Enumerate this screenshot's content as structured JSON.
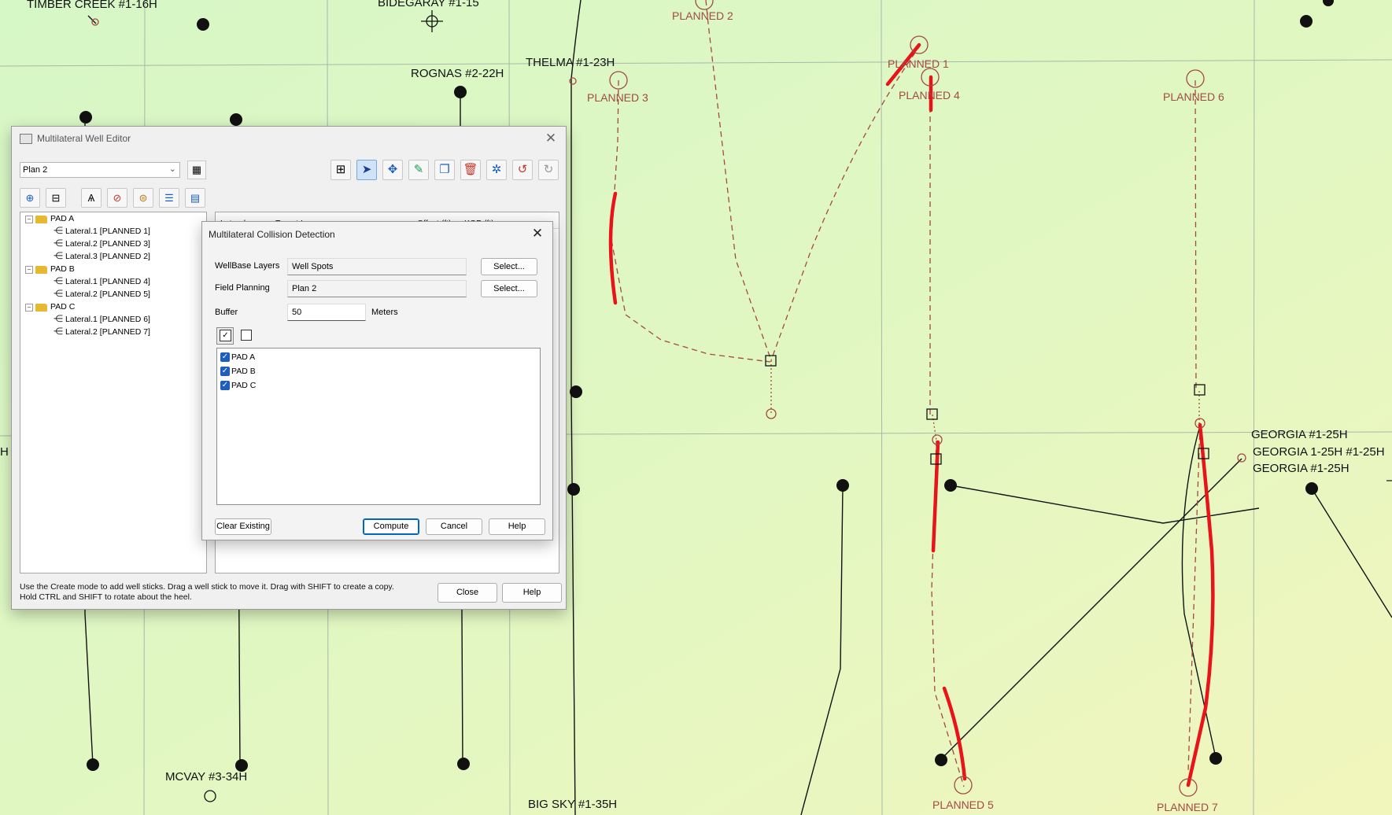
{
  "map": {
    "labels": {
      "timber_creek": "TIMBER CREEK #1-16H",
      "bidegaray": "BIDEGARAY #1-15",
      "rognas": "ROGNAS #2-22H",
      "thelma": "THELMA #1-23H",
      "georgia1": "GEORGIA #1-25H",
      "georgia2": "GEORGIA 1-25H #1-25H",
      "georgia3": "GEORGIA #1-25H",
      "mcvay": "MCVAY #3-34H",
      "bigsky": "BIG SKY #1-35H",
      "edge_h": "H"
    },
    "planned": {
      "p1": "PLANNED 1",
      "p2": "PLANNED 2",
      "p3": "PLANNED 3",
      "p4": "PLANNED 4",
      "p5": "PLANNED 5",
      "p6": "PLANNED 6",
      "p7": "PLANNED 7"
    },
    "colors": {
      "background_top": "#d9f7c4",
      "background_right": "#eff7c0",
      "planned_path": "#a24a45",
      "collision": "#e8141a",
      "grid": "#a8b4a8"
    }
  },
  "editor": {
    "title": "Multilateral Well Editor",
    "plan_select": "Plan 2",
    "toolbar_icons": [
      "new-well-icon",
      "select-arrow-icon",
      "move-icon",
      "pencil-icon",
      "copy-icon",
      "delete-icon",
      "collision-icon",
      "undo-icon",
      "redo-icon"
    ],
    "table_headers": [
      "Lateral",
      "Target Layer",
      "Offset (ft)",
      "KOP (ft)"
    ],
    "tree": [
      {
        "pad": "PAD A",
        "laterals": [
          "Lateral.1 [PLANNED 1]",
          "Lateral.2 [PLANNED 3]",
          "Lateral.3 [PLANNED 2]"
        ]
      },
      {
        "pad": "PAD B",
        "laterals": [
          "Lateral.1 [PLANNED 4]",
          "Lateral.2 [PLANNED 5]"
        ]
      },
      {
        "pad": "PAD C",
        "laterals": [
          "Lateral.1 [PLANNED 6]",
          "Lateral.2 [PLANNED 7]"
        ]
      }
    ],
    "status_line1": "Use the Create mode to add well sticks. Drag a well stick to move it. Drag with SHIFT to create a copy.",
    "status_line2": "Hold CTRL and SHIFT to rotate about the heel.",
    "close_label": "Close",
    "help_label": "Help"
  },
  "collision": {
    "title": "Multilateral Collision Detection",
    "wellbase_label": "WellBase Layers",
    "wellbase_value": "Well Spots",
    "field_label": "Field Planning",
    "field_value": "Plan 2",
    "select_label": "Select...",
    "buffer_label": "Buffer",
    "buffer_value": "50",
    "buffer_unit": "Meters",
    "pads": [
      "PAD A",
      "PAD B",
      "PAD C"
    ],
    "clear_label": "Clear Existing",
    "compute_label": "Compute",
    "cancel_label": "Cancel",
    "help_label": "Help"
  }
}
